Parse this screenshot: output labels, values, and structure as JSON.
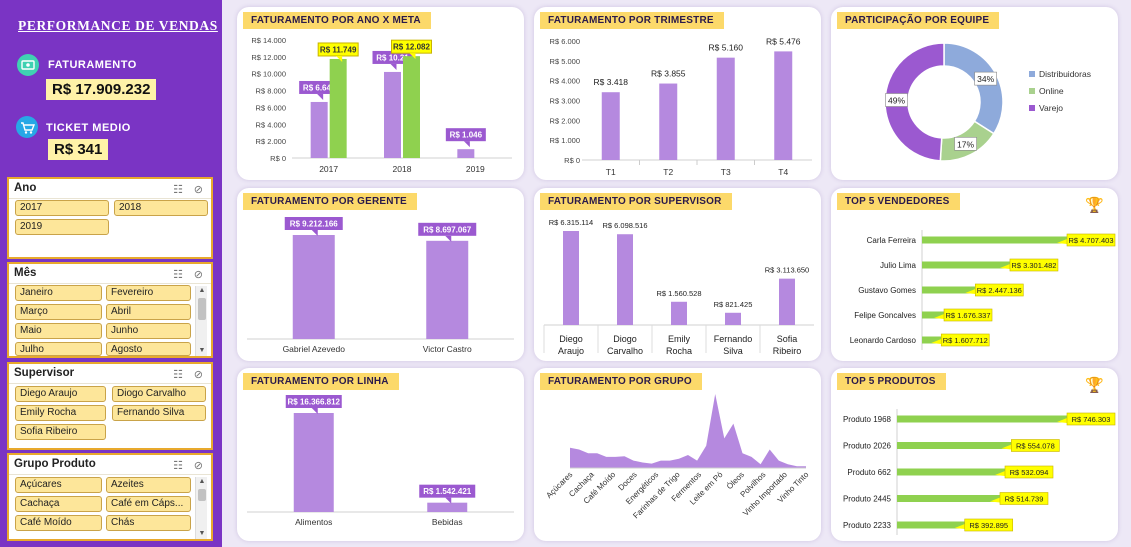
{
  "sidebar": {
    "title": "PERFORMANCE DE VENDAS",
    "faturamento_label": "FATURAMENTO",
    "faturamento_value": "R$ 17.909.232",
    "ticket_label": "TICKET MEDIO",
    "ticket_value": "R$ 341",
    "icons": [
      "money-icon",
      "cart-icon"
    ]
  },
  "slicers": {
    "ano": {
      "title": "Ano",
      "items": [
        "2017",
        "2018",
        "2019"
      ]
    },
    "mes": {
      "title": "Mês",
      "items": [
        "Janeiro",
        "Fevereiro",
        "Março",
        "Abril",
        "Maio",
        "Junho",
        "Julho",
        "Agosto"
      ]
    },
    "supervisor": {
      "title": "Supervisor",
      "items": [
        "Diego Araujo",
        "Diogo Carvalho",
        "Emily Rocha",
        "Fernando Silva",
        "Sofia Ribeiro"
      ]
    },
    "grupo": {
      "title": "Grupo Produto",
      "items": [
        "Açúcares",
        "Azeites",
        "Cachaça",
        "Café em Cáps...",
        "Café Moído",
        "Chás"
      ]
    }
  },
  "panels": {
    "ano_meta": "FATURAMENTO POR ANO X META",
    "trimestre": "FATURAMENTO POR TRIMESTRE",
    "equipe": "PARTICIPAÇÃO POR EQUIPE",
    "gerente": "FATURAMENTO POR GERENTE",
    "supervisor": "FATURAMENTO POR SUPERVISOR",
    "vendedores": "TOP 5 VENDEDORES",
    "linha": "FATURAMENTO POR LINHA",
    "grupo": "FATURAMENTO POR GRUPO",
    "produtos": "TOP 5 PRODUTOS"
  },
  "colors": {
    "purple": "#b589df",
    "green": "#8fd14f",
    "label_purple": "#9b59d0",
    "label_yellow": "#ffff00",
    "title_yellow": "#fcd96a",
    "sidebar": "#7a34c4",
    "blue": "#8eaadb"
  },
  "chart_data": [
    {
      "id": "ano_meta",
      "type": "bar",
      "categories": [
        "2017",
        "2018",
        "2019"
      ],
      "series": [
        {
          "values": [
            6648,
            10210,
            1046
          ],
          "labels": [
            "R$ 6.648",
            "R$ 10.21",
            "R$ 1.046"
          ]
        },
        {
          "values": [
            11749,
            12082,
            null
          ],
          "labels": [
            "R$ 11.749",
            "R$ 12.082",
            ""
          ]
        }
      ],
      "ylim": [
        0,
        14000
      ],
      "yticks": [
        "R$ 0",
        "R$ 2.000",
        "R$ 4.000",
        "R$ 6.000",
        "R$ 8.000",
        "R$ 10.000",
        "R$ 12.000",
        "R$ 14.000"
      ]
    },
    {
      "id": "trimestre",
      "type": "bar",
      "categories": [
        "T1",
        "T2",
        "T3",
        "T4"
      ],
      "values": [
        3418,
        3855,
        5160,
        5476
      ],
      "labels": [
        "R$ 3.418",
        "R$ 3.855",
        "R$ 5.160",
        "R$ 5.476"
      ],
      "ylim": [
        0,
        6000
      ],
      "yticks": [
        "R$ 0",
        "R$ 1.000",
        "R$ 2.000",
        "R$ 3.000",
        "R$ 4.000",
        "R$ 5.000",
        "R$ 6.000"
      ]
    },
    {
      "id": "equipe",
      "type": "pie",
      "categories": [
        "Distribuidoras",
        "Online",
        "Varejo"
      ],
      "values": [
        34,
        17,
        49
      ],
      "labels": [
        "34%",
        "17%",
        "49%"
      ],
      "colors": [
        "#8eaadb",
        "#a9d18e",
        "#9b59d0"
      ],
      "legend": "right"
    },
    {
      "id": "gerente",
      "type": "bar",
      "categories": [
        "Gabriel Azevedo",
        "Victor Castro"
      ],
      "values": [
        9212166,
        8697067
      ],
      "labels": [
        "R$ 9.212.166",
        "R$ 8.697.067"
      ]
    },
    {
      "id": "supervisor",
      "type": "bar",
      "categories": [
        "Diego Araujo",
        "Diogo Carvalho",
        "Emily Rocha",
        "Fernando Silva",
        "Sofia Ribeiro"
      ],
      "values": [
        6315114,
        6098516,
        1560528,
        821425,
        3113650
      ],
      "labels": [
        "R$ 6.315.114",
        "R$ 6.098.516",
        "R$ 1.560.528",
        "R$ 821.425",
        "R$ 3.113.650"
      ]
    },
    {
      "id": "vendedores",
      "type": "bar",
      "categories": [
        "Carla Ferreira",
        "Julio Lima",
        "Gustavo Gomes",
        "Felipe Goncalves",
        "Leonardo Cardoso"
      ],
      "values": [
        4707403,
        3301482,
        2447136,
        1676337,
        1607712
      ],
      "labels": [
        "R$ 4.707.403",
        "R$ 3.301.482",
        "R$ 2.447.136",
        "R$ 1.676.337",
        "R$ 1.607.712"
      ]
    },
    {
      "id": "linha",
      "type": "bar",
      "categories": [
        "Alimentos",
        "Bebidas"
      ],
      "values": [
        16366812,
        1542421
      ],
      "labels": [
        "R$ 16.366.812",
        "R$ 1.542.421"
      ]
    },
    {
      "id": "grupo",
      "type": "area",
      "categories": [
        "Açúcares",
        "Cachaça",
        "Café Moído",
        "Doces",
        "Energéticos",
        "Farinhas de Trigo",
        "Fermentos",
        "Leite em Pó",
        "Óleos",
        "Polvilhos",
        "Vinho Importado",
        "Vinho Tinto"
      ],
      "values": [
        0.55,
        0.5,
        0.4,
        0.4,
        0.3,
        0.3,
        0.32,
        0.2,
        0.15,
        0.12,
        0.2,
        0.2,
        0.25,
        0.35,
        0.2,
        0.6,
        2.0,
        0.8,
        1.2,
        0.4,
        0.3,
        0.1,
        0.5,
        0.2,
        0.1,
        0.05,
        0.05
      ]
    },
    {
      "id": "produtos",
      "type": "bar",
      "categories": [
        "Produto 1968",
        "Produto 2026",
        "Produto 662",
        "Produto 2445",
        "Produto 2233"
      ],
      "values": [
        746303,
        554078,
        532094,
        514739,
        392895
      ],
      "labels": [
        "R$ 746.303",
        "R$ 554.078",
        "R$ 532.094",
        "R$ 514.739",
        "R$ 392.895"
      ]
    }
  ]
}
